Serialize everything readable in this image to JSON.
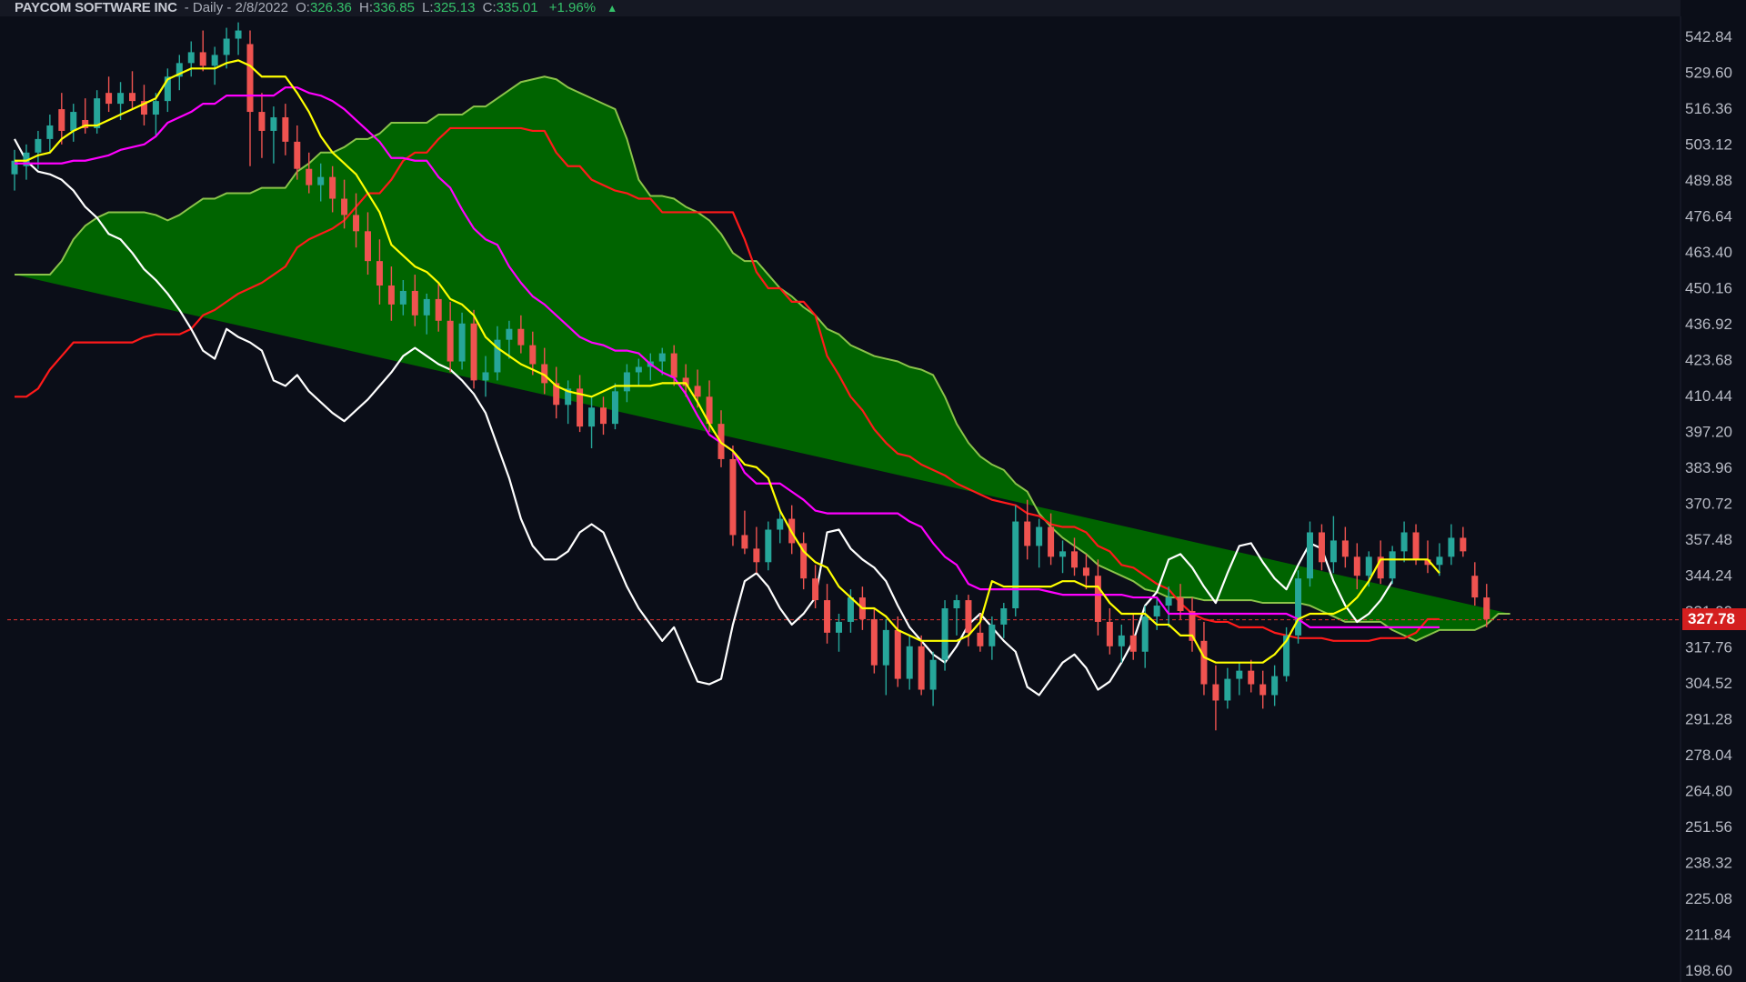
{
  "header": {
    "symbol": "PAYCOM SOFTWARE INC",
    "period": "- Daily - 2/8/2022",
    "open_label": "O:",
    "open": "326.36",
    "high_label": "H:",
    "high": "336.85",
    "low_label": "L:",
    "low": "325.13",
    "close_label": "C:",
    "close": "335.01",
    "change": "+1.96%",
    "change_icon": "up-triangle-icon"
  },
  "toolbar": {
    "icons": [
      "move-icon",
      "chevron-down-icon",
      "chevron-up-icon",
      "plus-icon"
    ]
  },
  "colors": {
    "background": "#0b0e18",
    "up_candle": "#26a69a",
    "down_candle": "#ef5350",
    "tenkan": "#ffff00",
    "kijun": "#ff00ff",
    "chikou": "#ffffff",
    "span_a": "#8bc34a",
    "span_b": "#ff1a1a",
    "cloud_fill": "#006400",
    "price_line": "#e03030"
  },
  "current_price": "327.78",
  "chart_data": {
    "type": "candlestick-ichimoku",
    "ylim": [
      198.6,
      542.84
    ],
    "y_ticks": [
      "542.84",
      "529.60",
      "516.36",
      "503.12",
      "489.88",
      "476.64",
      "463.40",
      "450.16",
      "436.92",
      "423.68",
      "410.44",
      "397.20",
      "383.96",
      "370.72",
      "357.48",
      "344.24",
      "331.00",
      "317.76",
      "304.52",
      "291.28",
      "278.04",
      "264.80",
      "251.56",
      "238.32",
      "225.08",
      "211.84",
      "198.60"
    ],
    "current_price": 327.78,
    "candles": [
      {
        "o": 492,
        "h": 501,
        "l": 486,
        "c": 497
      },
      {
        "o": 495,
        "h": 503,
        "l": 490,
        "c": 500
      },
      {
        "o": 500,
        "h": 508,
        "l": 494,
        "c": 505
      },
      {
        "o": 505,
        "h": 514,
        "l": 500,
        "c": 510
      },
      {
        "o": 516,
        "h": 522,
        "l": 503,
        "c": 508
      },
      {
        "o": 508,
        "h": 518,
        "l": 504,
        "c": 515
      },
      {
        "o": 512,
        "h": 520,
        "l": 507,
        "c": 509
      },
      {
        "o": 509,
        "h": 523,
        "l": 507,
        "c": 520
      },
      {
        "o": 522,
        "h": 528,
        "l": 515,
        "c": 518
      },
      {
        "o": 518,
        "h": 526,
        "l": 512,
        "c": 522
      },
      {
        "o": 522,
        "h": 530,
        "l": 516,
        "c": 519
      },
      {
        "o": 519,
        "h": 525,
        "l": 510,
        "c": 514
      },
      {
        "o": 514,
        "h": 522,
        "l": 506,
        "c": 519
      },
      {
        "o": 519,
        "h": 531,
        "l": 515,
        "c": 528
      },
      {
        "o": 528,
        "h": 536,
        "l": 523,
        "c": 533
      },
      {
        "o": 533,
        "h": 541,
        "l": 528,
        "c": 537
      },
      {
        "o": 537,
        "h": 545,
        "l": 530,
        "c": 532
      },
      {
        "o": 532,
        "h": 539,
        "l": 525,
        "c": 536
      },
      {
        "o": 536,
        "h": 546,
        "l": 531,
        "c": 542
      },
      {
        "o": 542,
        "h": 548,
        "l": 536,
        "c": 545
      },
      {
        "o": 540,
        "h": 545,
        "l": 495,
        "c": 515
      },
      {
        "o": 515,
        "h": 522,
        "l": 498,
        "c": 508
      },
      {
        "o": 508,
        "h": 517,
        "l": 496,
        "c": 513
      },
      {
        "o": 513,
        "h": 518,
        "l": 499,
        "c": 504
      },
      {
        "o": 504,
        "h": 510,
        "l": 490,
        "c": 494
      },
      {
        "o": 494,
        "h": 500,
        "l": 485,
        "c": 488
      },
      {
        "o": 488,
        "h": 496,
        "l": 482,
        "c": 491
      },
      {
        "o": 491,
        "h": 495,
        "l": 478,
        "c": 483
      },
      {
        "o": 483,
        "h": 490,
        "l": 472,
        "c": 477
      },
      {
        "o": 477,
        "h": 485,
        "l": 465,
        "c": 471
      },
      {
        "o": 471,
        "h": 478,
        "l": 455,
        "c": 460
      },
      {
        "o": 460,
        "h": 468,
        "l": 444,
        "c": 451
      },
      {
        "o": 451,
        "h": 458,
        "l": 438,
        "c": 444
      },
      {
        "o": 444,
        "h": 453,
        "l": 440,
        "c": 449
      },
      {
        "o": 449,
        "h": 455,
        "l": 436,
        "c": 440
      },
      {
        "o": 440,
        "h": 448,
        "l": 433,
        "c": 446
      },
      {
        "o": 446,
        "h": 452,
        "l": 434,
        "c": 438
      },
      {
        "o": 438,
        "h": 445,
        "l": 419,
        "c": 423
      },
      {
        "o": 423,
        "h": 441,
        "l": 420,
        "c": 437
      },
      {
        "o": 437,
        "h": 442,
        "l": 413,
        "c": 416
      },
      {
        "o": 416,
        "h": 425,
        "l": 410,
        "c": 419
      },
      {
        "o": 419,
        "h": 436,
        "l": 416,
        "c": 431
      },
      {
        "o": 431,
        "h": 438,
        "l": 424,
        "c": 435
      },
      {
        "o": 435,
        "h": 440,
        "l": 426,
        "c": 429
      },
      {
        "o": 429,
        "h": 434,
        "l": 418,
        "c": 422
      },
      {
        "o": 422,
        "h": 428,
        "l": 411,
        "c": 415
      },
      {
        "o": 415,
        "h": 421,
        "l": 402,
        "c": 407
      },
      {
        "o": 407,
        "h": 416,
        "l": 400,
        "c": 413
      },
      {
        "o": 413,
        "h": 418,
        "l": 397,
        "c": 399
      },
      {
        "o": 399,
        "h": 410,
        "l": 391,
        "c": 406
      },
      {
        "o": 406,
        "h": 410,
        "l": 396,
        "c": 400
      },
      {
        "o": 400,
        "h": 415,
        "l": 398,
        "c": 412
      },
      {
        "o": 412,
        "h": 422,
        "l": 408,
        "c": 419
      },
      {
        "o": 419,
        "h": 424,
        "l": 414,
        "c": 421
      },
      {
        "o": 421,
        "h": 426,
        "l": 416,
        "c": 423
      },
      {
        "o": 423,
        "h": 428,
        "l": 418,
        "c": 426
      },
      {
        "o": 426,
        "h": 429,
        "l": 414,
        "c": 417
      },
      {
        "o": 417,
        "h": 422,
        "l": 410,
        "c": 414
      },
      {
        "o": 414,
        "h": 420,
        "l": 406,
        "c": 410
      },
      {
        "o": 410,
        "h": 416,
        "l": 397,
        "c": 400
      },
      {
        "o": 400,
        "h": 405,
        "l": 384,
        "c": 387
      },
      {
        "o": 387,
        "h": 392,
        "l": 355,
        "c": 359
      },
      {
        "o": 359,
        "h": 368,
        "l": 352,
        "c": 354
      },
      {
        "o": 354,
        "h": 362,
        "l": 345,
        "c": 349
      },
      {
        "o": 349,
        "h": 364,
        "l": 346,
        "c": 361
      },
      {
        "o": 361,
        "h": 368,
        "l": 356,
        "c": 365
      },
      {
        "o": 365,
        "h": 370,
        "l": 352,
        "c": 356
      },
      {
        "o": 356,
        "h": 360,
        "l": 339,
        "c": 343
      },
      {
        "o": 343,
        "h": 348,
        "l": 332,
        "c": 335
      },
      {
        "o": 335,
        "h": 341,
        "l": 319,
        "c": 323
      },
      {
        "o": 323,
        "h": 330,
        "l": 316,
        "c": 327
      },
      {
        "o": 327,
        "h": 339,
        "l": 323,
        "c": 336
      },
      {
        "o": 336,
        "h": 340,
        "l": 324,
        "c": 328
      },
      {
        "o": 328,
        "h": 332,
        "l": 308,
        "c": 311
      },
      {
        "o": 311,
        "h": 328,
        "l": 300,
        "c": 324
      },
      {
        "o": 324,
        "h": 329,
        "l": 303,
        "c": 306
      },
      {
        "o": 306,
        "h": 322,
        "l": 302,
        "c": 318
      },
      {
        "o": 318,
        "h": 322,
        "l": 300,
        "c": 302
      },
      {
        "o": 302,
        "h": 316,
        "l": 296,
        "c": 313
      },
      {
        "o": 313,
        "h": 335,
        "l": 309,
        "c": 332
      },
      {
        "o": 332,
        "h": 337,
        "l": 322,
        "c": 335
      },
      {
        "o": 335,
        "h": 337,
        "l": 318,
        "c": 323
      },
      {
        "o": 323,
        "h": 330,
        "l": 316,
        "c": 318
      },
      {
        "o": 318,
        "h": 329,
        "l": 313,
        "c": 326
      },
      {
        "o": 326,
        "h": 334,
        "l": 321,
        "c": 332
      },
      {
        "o": 332,
        "h": 370,
        "l": 329,
        "c": 364
      },
      {
        "o": 364,
        "h": 372,
        "l": 350,
        "c": 355
      },
      {
        "o": 355,
        "h": 365,
        "l": 347,
        "c": 362
      },
      {
        "o": 362,
        "h": 367,
        "l": 348,
        "c": 351
      },
      {
        "o": 351,
        "h": 357,
        "l": 345,
        "c": 353
      },
      {
        "o": 353,
        "h": 358,
        "l": 344,
        "c": 347
      },
      {
        "o": 347,
        "h": 352,
        "l": 339,
        "c": 344
      },
      {
        "o": 344,
        "h": 350,
        "l": 322,
        "c": 327
      },
      {
        "o": 327,
        "h": 332,
        "l": 315,
        "c": 318
      },
      {
        "o": 318,
        "h": 326,
        "l": 312,
        "c": 322
      },
      {
        "o": 322,
        "h": 330,
        "l": 313,
        "c": 316
      },
      {
        "o": 316,
        "h": 333,
        "l": 310,
        "c": 329
      },
      {
        "o": 329,
        "h": 336,
        "l": 324,
        "c": 333
      },
      {
        "o": 333,
        "h": 340,
        "l": 325,
        "c": 336
      },
      {
        "o": 336,
        "h": 341,
        "l": 328,
        "c": 331
      },
      {
        "o": 331,
        "h": 336,
        "l": 316,
        "c": 320
      },
      {
        "o": 320,
        "h": 327,
        "l": 300,
        "c": 304
      },
      {
        "o": 304,
        "h": 311,
        "l": 287,
        "c": 298
      },
      {
        "o": 298,
        "h": 310,
        "l": 295,
        "c": 306
      },
      {
        "o": 306,
        "h": 312,
        "l": 300,
        "c": 309
      },
      {
        "o": 309,
        "h": 313,
        "l": 301,
        "c": 304
      },
      {
        "o": 304,
        "h": 309,
        "l": 295,
        "c": 300
      },
      {
        "o": 300,
        "h": 311,
        "l": 296,
        "c": 307
      },
      {
        "o": 307,
        "h": 325,
        "l": 305,
        "c": 322
      },
      {
        "o": 322,
        "h": 346,
        "l": 319,
        "c": 343
      },
      {
        "o": 343,
        "h": 364,
        "l": 340,
        "c": 360
      },
      {
        "o": 360,
        "h": 363,
        "l": 346,
        "c": 349
      },
      {
        "o": 349,
        "h": 366,
        "l": 345,
        "c": 357
      },
      {
        "o": 357,
        "h": 362,
        "l": 347,
        "c": 351
      },
      {
        "o": 351,
        "h": 356,
        "l": 339,
        "c": 344
      },
      {
        "o": 344,
        "h": 353,
        "l": 340,
        "c": 351
      },
      {
        "o": 351,
        "h": 357,
        "l": 341,
        "c": 343
      },
      {
        "o": 343,
        "h": 355,
        "l": 341,
        "c": 353
      },
      {
        "o": 353,
        "h": 364,
        "l": 349,
        "c": 360
      },
      {
        "o": 360,
        "h": 363,
        "l": 348,
        "c": 350
      },
      {
        "o": 350,
        "h": 357,
        "l": 345,
        "c": 348
      },
      {
        "o": 348,
        "h": 356,
        "l": 344,
        "c": 351
      },
      {
        "o": 351,
        "h": 363,
        "l": 348,
        "c": 358
      },
      {
        "o": 358,
        "h": 362,
        "l": 351,
        "c": 353
      },
      {
        "o": 344,
        "h": 349,
        "l": 333,
        "c": 336
      },
      {
        "o": 336,
        "h": 341,
        "l": 325,
        "c": 328
      }
    ],
    "tenkan": [
      497,
      497,
      499,
      500,
      505,
      508,
      510,
      510,
      512,
      514,
      516,
      518,
      520,
      527,
      529,
      531,
      531,
      531,
      533,
      534,
      532,
      528,
      528,
      528,
      522,
      515,
      506,
      500,
      496,
      492,
      485,
      478,
      466,
      462,
      458,
      456,
      452,
      446,
      444,
      440,
      432,
      428,
      425,
      422,
      420,
      418,
      414,
      412,
      411,
      410,
      412,
      414,
      414,
      414,
      414,
      415,
      415,
      415,
      408,
      400,
      393,
      390,
      385,
      384,
      380,
      368,
      360,
      353,
      349,
      347,
      340,
      336,
      332,
      332,
      329,
      324,
      322,
      320,
      320,
      320,
      320,
      322,
      327,
      342,
      340,
      340,
      340,
      340,
      340,
      342,
      342,
      340,
      340,
      334,
      330,
      330,
      330,
      326,
      326,
      322,
      322,
      314,
      312,
      312,
      312,
      312,
      312,
      315,
      320,
      328,
      330,
      330,
      330,
      332,
      336,
      342,
      350,
      350,
      350,
      350,
      350,
      345
    ],
    "kijun": [
      496,
      496,
      496,
      496,
      496,
      497,
      497,
      498,
      499,
      501,
      502,
      503,
      506,
      511,
      513,
      515,
      518,
      518,
      521,
      521,
      521,
      521,
      521,
      524,
      524,
      522,
      521,
      519,
      516,
      512,
      508,
      504,
      498,
      498,
      497,
      497,
      491,
      487,
      479,
      472,
      468,
      466,
      458,
      452,
      447,
      444,
      440,
      436,
      432,
      430,
      429,
      427,
      427,
      426,
      422,
      419,
      417,
      411,
      403,
      396,
      393,
      390,
      382,
      378,
      378,
      378,
      375,
      372,
      368,
      367,
      367,
      367,
      367,
      367,
      367,
      367,
      364,
      362,
      356,
      351,
      348,
      341,
      339,
      339,
      339,
      339,
      339,
      339,
      338,
      337,
      337,
      337,
      337,
      337,
      337,
      336,
      336,
      336,
      330,
      330,
      330,
      330,
      330,
      330,
      330,
      330,
      330,
      330,
      330,
      328,
      325,
      325,
      325,
      325,
      325,
      325,
      325,
      325,
      325,
      325,
      325,
      325
    ],
    "chikou": [
      505,
      497,
      493,
      492,
      490,
      486,
      480,
      476,
      470,
      468,
      463,
      457,
      453,
      448,
      442,
      435,
      427,
      424,
      435,
      432,
      430,
      427,
      416,
      414,
      418,
      412,
      408,
      404,
      401,
      405,
      409,
      414,
      419,
      425,
      428,
      425,
      422,
      420,
      416,
      411,
      404,
      392,
      380,
      365,
      355,
      350,
      350,
      353,
      360,
      363,
      360,
      350,
      340,
      332,
      326,
      320,
      325,
      315,
      305,
      304,
      306,
      326,
      342,
      345,
      340,
      332,
      326,
      330,
      336,
      360,
      361,
      354,
      350,
      347,
      342,
      333,
      325,
      320,
      315,
      312,
      318,
      326,
      330,
      325,
      320,
      316,
      303,
      300,
      306,
      312,
      315,
      310,
      302,
      305,
      312,
      320,
      333,
      338,
      350,
      352,
      347,
      340,
      334,
      345,
      355,
      356,
      349,
      343,
      339,
      348,
      356,
      354,
      342,
      333,
      327,
      330,
      335,
      342
    ],
    "span_a": [
      455,
      455,
      455,
      455,
      460,
      468,
      473,
      476,
      478,
      478,
      478,
      478,
      477,
      475,
      477,
      480,
      483,
      483,
      485,
      485,
      485,
      487,
      487,
      487,
      493,
      496,
      500,
      500,
      502,
      505,
      505,
      507,
      511,
      511,
      511,
      511,
      514,
      514,
      514,
      517,
      517,
      520,
      523,
      526,
      527,
      528,
      527,
      524,
      522,
      520,
      518,
      516,
      505,
      490,
      484,
      484,
      483,
      480,
      478,
      475,
      470,
      463,
      460,
      460,
      455,
      450,
      447,
      443,
      440,
      435,
      433,
      429,
      427,
      425,
      424,
      423,
      421,
      420,
      418,
      410,
      400,
      393,
      388,
      385,
      383,
      378,
      375,
      367,
      362,
      358,
      355,
      352,
      348,
      346,
      344,
      342,
      339,
      338,
      336,
      336,
      336,
      335,
      335,
      335,
      335,
      335,
      334,
      334,
      334,
      334,
      333,
      331,
      329,
      327,
      327,
      327,
      327,
      324,
      322,
      320,
      322,
      324,
      324,
      324,
      324,
      326,
      330,
      330
    ],
    "span_b": [
      410,
      410,
      413,
      420,
      425,
      430,
      430,
      430,
      430,
      430,
      430,
      432,
      433,
      433,
      433,
      435,
      440,
      442,
      445,
      448,
      450,
      452,
      455,
      458,
      465,
      468,
      470,
      472,
      475,
      480,
      485,
      485,
      490,
      497,
      500,
      500,
      505,
      509,
      509,
      509,
      509,
      509,
      509,
      509,
      508,
      508,
      500,
      495,
      495,
      490,
      488,
      486,
      485,
      483,
      483,
      478,
      478,
      478,
      478,
      478,
      478,
      478,
      468,
      456,
      450,
      450,
      445,
      445,
      440,
      425,
      418,
      410,
      405,
      398,
      393,
      389,
      388,
      385,
      383,
      381,
      378,
      376,
      374,
      372,
      371,
      370,
      367,
      366,
      363,
      362,
      362,
      360,
      355,
      353,
      348,
      347,
      344,
      341,
      339,
      334,
      330,
      328,
      327,
      327,
      325,
      325,
      325,
      323,
      322,
      321,
      321,
      321,
      320,
      320,
      320,
      320,
      321,
      321,
      321,
      323,
      328,
      328
    ]
  }
}
